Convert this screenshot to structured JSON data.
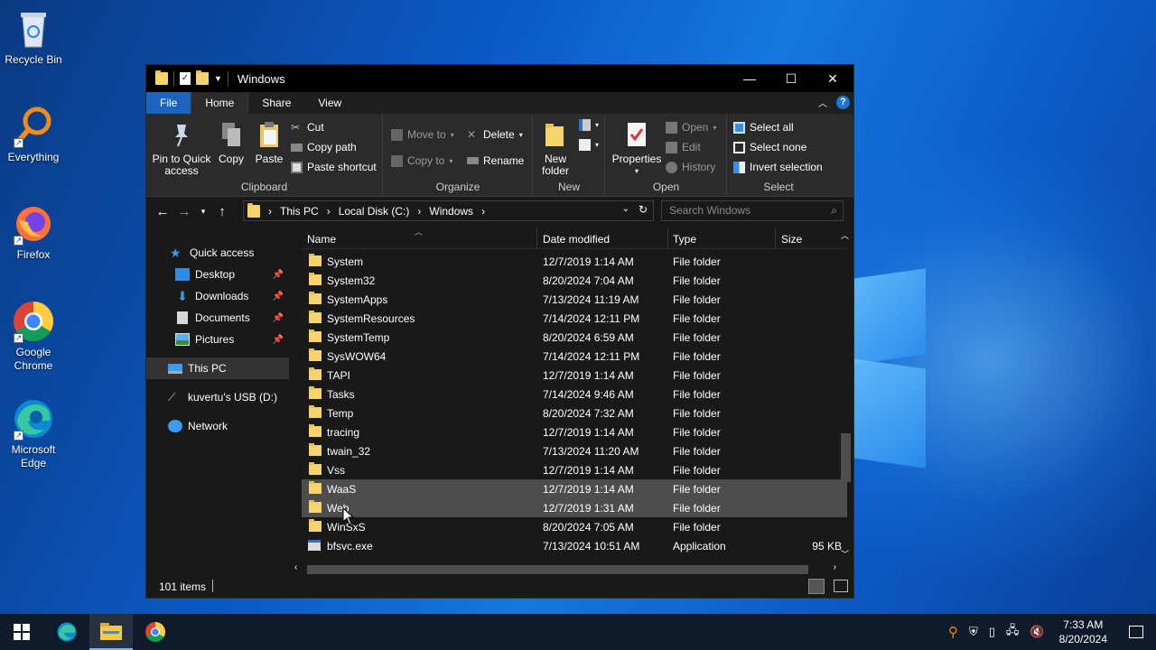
{
  "desktop": {
    "icons": [
      {
        "label": "Recycle Bin",
        "icon": "recycle-bin-icon"
      },
      {
        "label": "Everything",
        "icon": "everything-search-icon"
      },
      {
        "label": "Firefox",
        "icon": "firefox-icon"
      },
      {
        "label": "Google Chrome",
        "icon": "chrome-icon"
      },
      {
        "label": "Microsoft Edge",
        "icon": "edge-icon"
      }
    ]
  },
  "window": {
    "title": "Windows",
    "controls": {
      "minimize": "—",
      "maximize": "☐",
      "close": "✕"
    },
    "menu": {
      "file": "File",
      "home": "Home",
      "share": "Share",
      "view": "View"
    }
  },
  "ribbon": {
    "clipboard": {
      "label": "Clipboard",
      "pin": "Pin to Quick access",
      "copy": "Copy",
      "paste": "Paste",
      "cut": "Cut",
      "copy_path": "Copy path",
      "paste_shortcut": "Paste shortcut"
    },
    "organize": {
      "label": "Organize",
      "move_to": "Move to",
      "copy_to": "Copy to",
      "delete": "Delete",
      "rename": "Rename"
    },
    "new": {
      "label": "New",
      "new_folder": "New folder"
    },
    "open": {
      "label": "Open",
      "properties": "Properties",
      "open": "Open",
      "edit": "Edit",
      "history": "History"
    },
    "select": {
      "label": "Select",
      "select_all": "Select all",
      "select_none": "Select none",
      "invert": "Invert selection"
    }
  },
  "address": {
    "crumbs": [
      "This PC",
      "Local Disk (C:)",
      "Windows"
    ],
    "search_placeholder": "Search Windows"
  },
  "nav": {
    "quick_access": "Quick access",
    "desktop": "Desktop",
    "downloads": "Downloads",
    "documents": "Documents",
    "pictures": "Pictures",
    "this_pc": "This PC",
    "usb": "kuvertu's USB (D:)",
    "network": "Network"
  },
  "columns": {
    "name": "Name",
    "date": "Date modified",
    "type": "Type",
    "size": "Size"
  },
  "files": [
    {
      "name": "System",
      "date": "12/7/2019 1:14 AM",
      "type": "File folder",
      "size": ""
    },
    {
      "name": "System32",
      "date": "8/20/2024 7:04 AM",
      "type": "File folder",
      "size": ""
    },
    {
      "name": "SystemApps",
      "date": "7/13/2024 11:19 AM",
      "type": "File folder",
      "size": ""
    },
    {
      "name": "SystemResources",
      "date": "7/14/2024 12:11 PM",
      "type": "File folder",
      "size": ""
    },
    {
      "name": "SystemTemp",
      "date": "8/20/2024 6:59 AM",
      "type": "File folder",
      "size": ""
    },
    {
      "name": "SysWOW64",
      "date": "7/14/2024 12:11 PM",
      "type": "File folder",
      "size": ""
    },
    {
      "name": "TAPI",
      "date": "12/7/2019 1:14 AM",
      "type": "File folder",
      "size": ""
    },
    {
      "name": "Tasks",
      "date": "7/14/2024 9:46 AM",
      "type": "File folder",
      "size": ""
    },
    {
      "name": "Temp",
      "date": "8/20/2024 7:32 AM",
      "type": "File folder",
      "size": ""
    },
    {
      "name": "tracing",
      "date": "12/7/2019 1:14 AM",
      "type": "File folder",
      "size": ""
    },
    {
      "name": "twain_32",
      "date": "7/13/2024 11:20 AM",
      "type": "File folder",
      "size": ""
    },
    {
      "name": "Vss",
      "date": "12/7/2019 1:14 AM",
      "type": "File folder",
      "size": ""
    },
    {
      "name": "WaaS",
      "date": "12/7/2019 1:14 AM",
      "type": "File folder",
      "size": ""
    },
    {
      "name": "Web",
      "date": "12/7/2019 1:31 AM",
      "type": "File folder",
      "size": ""
    },
    {
      "name": "WinSxS",
      "date": "8/20/2024 7:05 AM",
      "type": "File folder",
      "size": ""
    },
    {
      "name": "bfsvc.exe",
      "date": "7/13/2024 10:51 AM",
      "type": "Application",
      "size": "95 KB"
    }
  ],
  "status": {
    "items": "101 items"
  },
  "taskbar": {
    "time": "7:33 AM",
    "date": "8/20/2024"
  }
}
